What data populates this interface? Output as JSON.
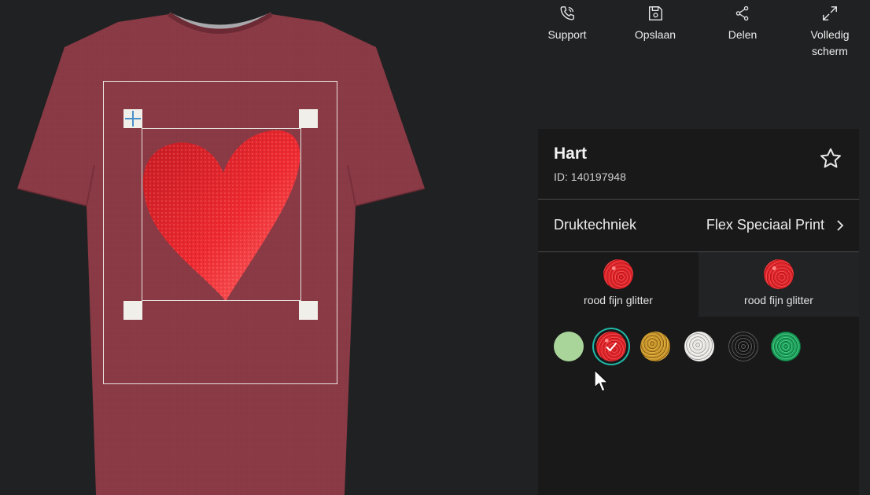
{
  "toolbar": {
    "items": [
      {
        "label": "Support",
        "icon": "phone-icon"
      },
      {
        "label": "Opslaan",
        "icon": "save-icon"
      },
      {
        "label": "Delen",
        "icon": "share-icon"
      },
      {
        "label": "Volledig scherm",
        "icon": "fullscreen-icon"
      }
    ]
  },
  "design": {
    "title": "Hart",
    "id_text": "ID: 140197948",
    "favorite_icon": "star-icon"
  },
  "technique": {
    "label": "Druktechniek",
    "value": "Flex Speciaal Print"
  },
  "color_tabs": [
    {
      "label": "rood fijn glitter",
      "swatch": "red-glitter"
    },
    {
      "label": "rood fijn glitter",
      "swatch": "red-glitter"
    }
  ],
  "swatches": [
    {
      "name": "light-green",
      "color": "#a9d49a",
      "selected": false
    },
    {
      "name": "red-glitter",
      "color": "#d9232a",
      "selected": true
    },
    {
      "name": "gold-glitter",
      "color": "#c8962a",
      "selected": false
    },
    {
      "name": "silver-glitter",
      "color": "#e0ddd8",
      "selected": false
    },
    {
      "name": "black-glitter",
      "color": "#222222",
      "selected": false
    },
    {
      "name": "green-glitter",
      "color": "#1fa35e",
      "selected": false
    }
  ],
  "colors": {
    "shirt": "#8a3a45",
    "heart": "#e8242b",
    "accent": "#1fb8a8",
    "panel": "#191919",
    "background": "#202122"
  }
}
